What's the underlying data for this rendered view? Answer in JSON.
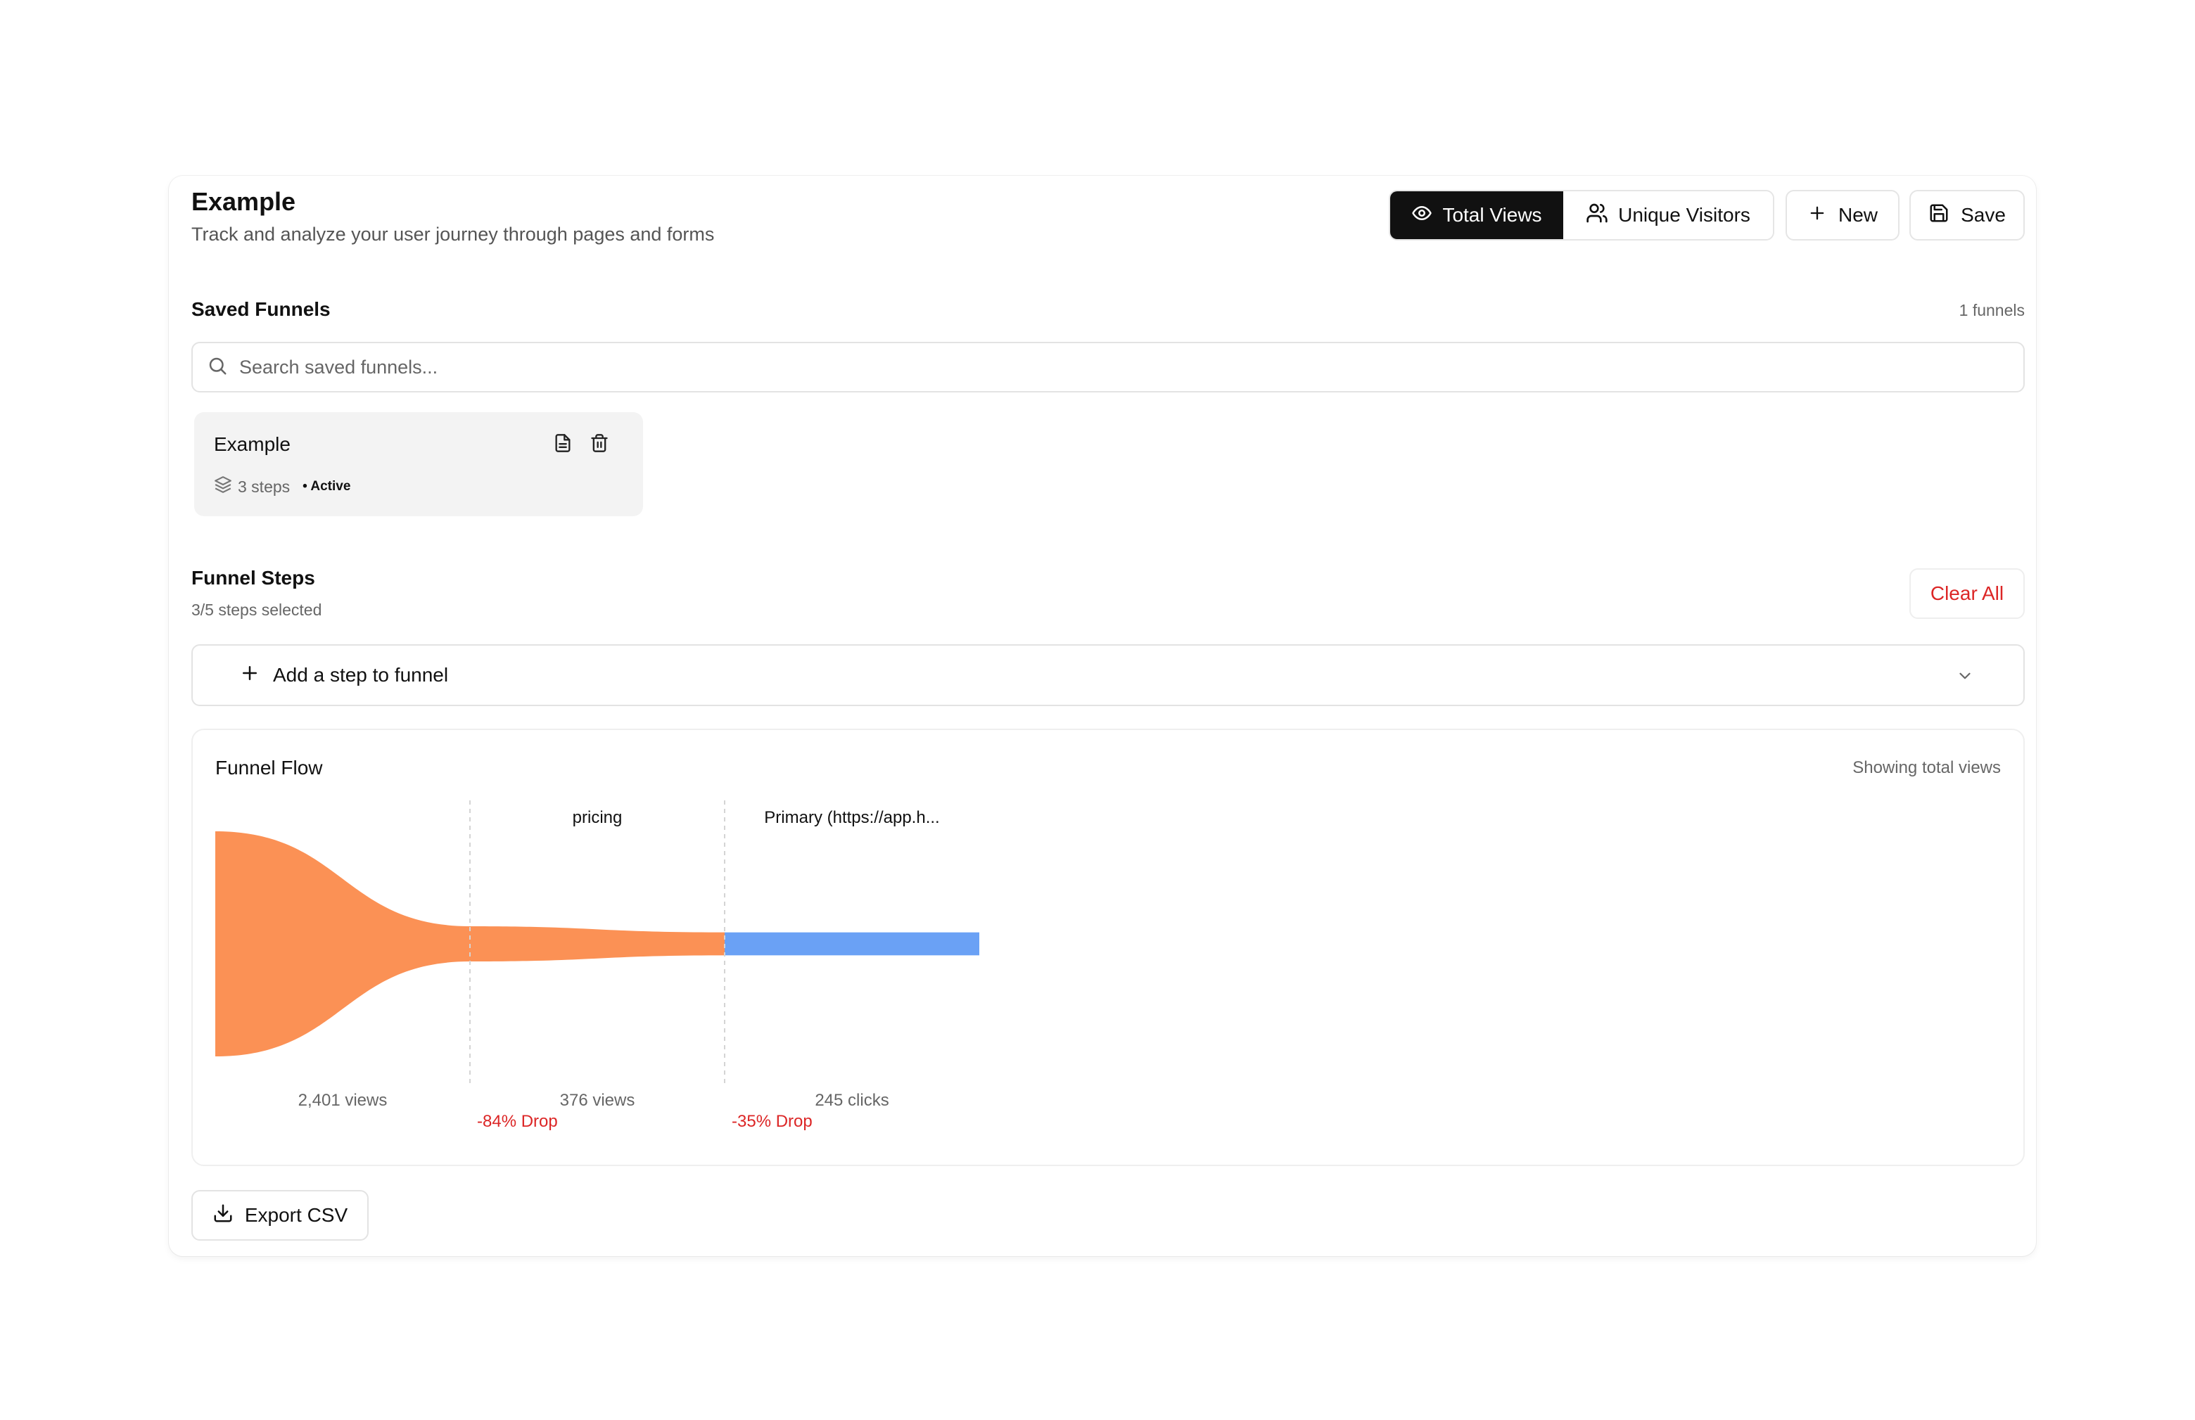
{
  "header": {
    "title": "Example",
    "subtitle": "Track and analyze your user journey through pages and forms"
  },
  "toolbar": {
    "total_views_label": "Total Views",
    "unique_visitors_label": "Unique Visitors",
    "new_label": "New",
    "save_label": "Save"
  },
  "saved_funnels": {
    "title": "Saved Funnels",
    "count_label": "1 funnels",
    "search_placeholder": "Search saved funnels...",
    "items": [
      {
        "name": "Example",
        "steps_label": "3 steps",
        "status": "• Active"
      }
    ]
  },
  "funnel_steps": {
    "title": "Funnel Steps",
    "selected_label": "3/5 steps selected",
    "clear_label": "Clear All",
    "add_step_label": "Add a step to funnel"
  },
  "funnel_flow": {
    "title": "Funnel Flow",
    "mode_label": "Showing total views"
  },
  "export_label": "Export CSV",
  "colors": {
    "views_stage": "#fb9155",
    "clicks_stage": "#6aa1f5",
    "drop": "#dc2626",
    "active_toggle_bg": "#111111"
  },
  "chart_data": {
    "type": "funnel",
    "stages": [
      {
        "name": "",
        "value": 2401,
        "metric": "views",
        "value_label": "2,401 views",
        "drop_label": ""
      },
      {
        "name": "pricing",
        "value": 376,
        "metric": "views",
        "value_label": "376 views",
        "drop_label": "-84% Drop"
      },
      {
        "name": "Primary (https://app.h...",
        "value": 245,
        "metric": "clicks",
        "value_label": "245 clicks",
        "drop_label": "-35% Drop"
      }
    ]
  }
}
